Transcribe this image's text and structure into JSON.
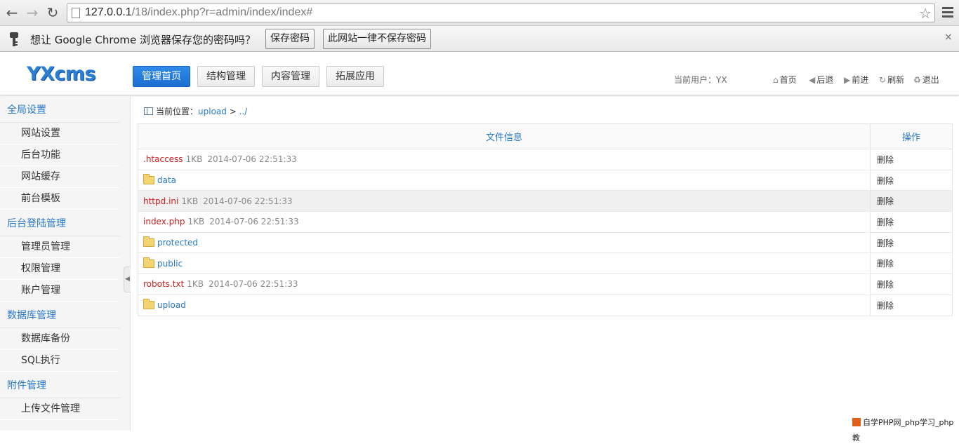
{
  "browser": {
    "url_host": "127.0.0.1",
    "url_rest": "/18/index.php?r=admin/index/index#"
  },
  "infobar": {
    "message": "想让 Google Chrome 浏览器保存您的密码吗？",
    "save_label": "保存密码",
    "never_label": "此网站一律不保存密码",
    "close": "×"
  },
  "header": {
    "logo": "YXcms",
    "nav": [
      "管理首页",
      "结构管理",
      "内容管理",
      "拓展应用"
    ],
    "current_user": "当前用户：YX",
    "links": [
      "首页",
      "后退",
      "前进",
      "刷新",
      "退出"
    ]
  },
  "sidebar": {
    "sections": [
      {
        "title": "全局设置",
        "items": [
          "网站设置",
          "后台功能",
          "网站缓存",
          "前台模板"
        ]
      },
      {
        "title": "后台登陆管理",
        "items": [
          "管理员管理",
          "权限管理",
          "账户管理"
        ]
      },
      {
        "title": "数据库管理",
        "items": [
          "数据库备份",
          "SQL执行"
        ]
      },
      {
        "title": "附件管理",
        "items": [
          "上传文件管理"
        ]
      }
    ]
  },
  "breadcrumb": {
    "label": "当前位置：",
    "path1": "upload",
    "sep": ">",
    "path2": "../"
  },
  "table": {
    "col_info": "文件信息",
    "col_op": "操作",
    "rows": [
      {
        "name": ".htaccess",
        "type": "file",
        "size": "1KB",
        "time": "2014-07-06 22:51:33",
        "op": "删除"
      },
      {
        "name": "data",
        "type": "dir",
        "op": "删除"
      },
      {
        "name": "httpd.ini",
        "type": "file",
        "size": "1KB",
        "time": "2014-07-06 22:51:33",
        "op": "删除"
      },
      {
        "name": "index.php",
        "type": "file",
        "size": "1KB",
        "time": "2014-07-06 22:51:33",
        "op": "删除"
      },
      {
        "name": "protected",
        "type": "dir",
        "op": "删除"
      },
      {
        "name": "public",
        "type": "dir",
        "op": "删除"
      },
      {
        "name": "robots.txt",
        "type": "file",
        "size": "1KB",
        "time": "2014-07-06 22:51:33",
        "op": "删除"
      },
      {
        "name": "upload",
        "type": "dir",
        "op": "删除"
      }
    ]
  },
  "watermark": "自学PHP网_php学习_php教"
}
